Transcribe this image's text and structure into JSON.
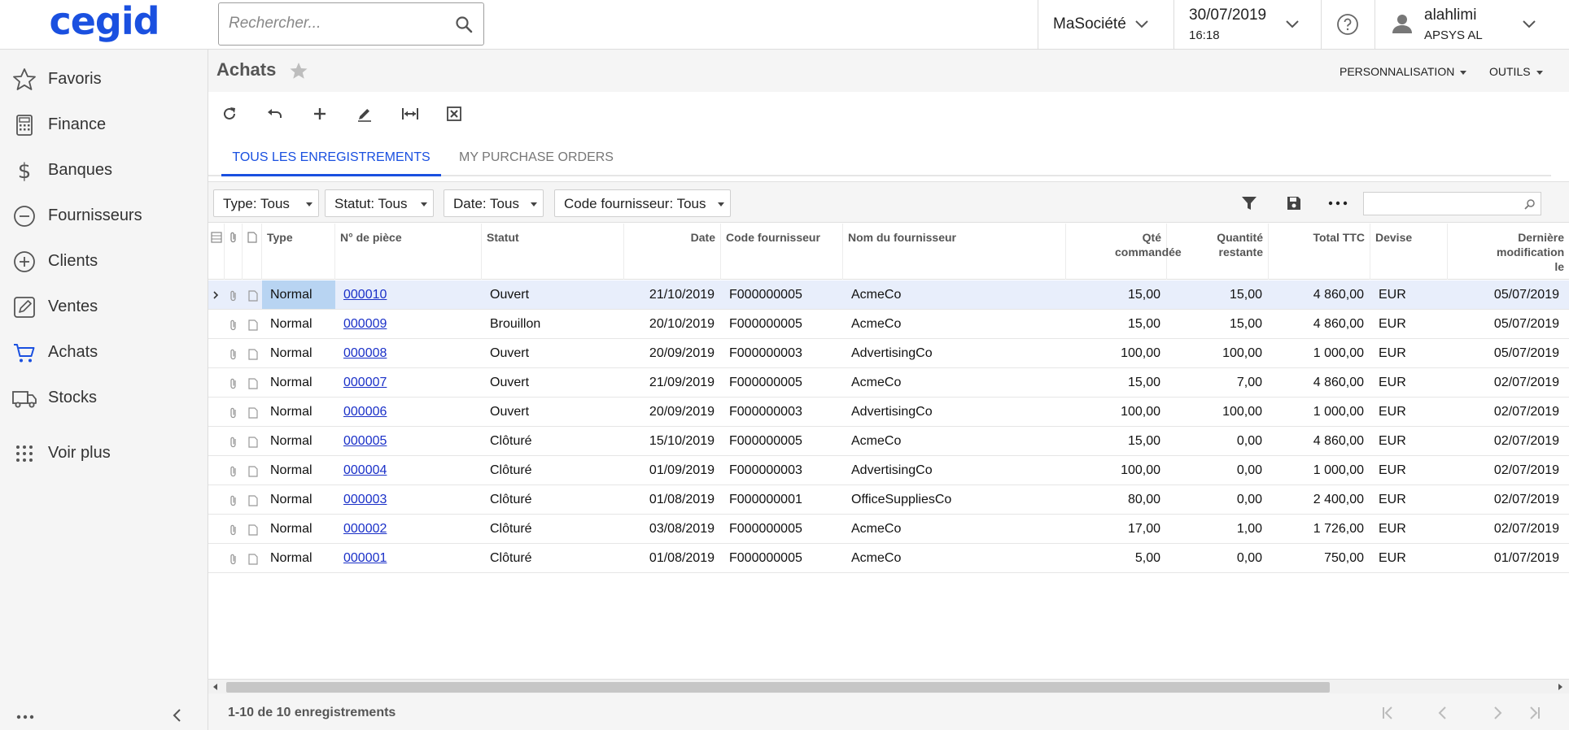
{
  "brand": {
    "logo_text": "cegid",
    "color": "#1a50e0"
  },
  "search": {
    "placeholder": "Rechercher..."
  },
  "company": {
    "label": "MaSociété"
  },
  "business_date": {
    "date": "30/07/2019",
    "time": "16:18"
  },
  "user": {
    "name": "alahlimi",
    "company": "APSYS AL"
  },
  "sidebar": {
    "items": [
      {
        "label": "Favoris",
        "icon": "star-icon"
      },
      {
        "label": "Finance",
        "icon": "calculator-icon"
      },
      {
        "label": "Banques",
        "icon": "dollar-icon"
      },
      {
        "label": "Fournisseurs",
        "icon": "minus-circle-icon"
      },
      {
        "label": "Clients",
        "icon": "plus-circle-icon"
      },
      {
        "label": "Ventes",
        "icon": "edit-icon"
      },
      {
        "label": "Achats",
        "icon": "cart-icon"
      },
      {
        "label": "Stocks",
        "icon": "truck-icon"
      },
      {
        "label": "Voir plus",
        "icon": "grid-dots-icon"
      }
    ]
  },
  "page": {
    "title": "Achats",
    "menus": {
      "customize": "PERSONNALISATION",
      "tools": "OUTILS"
    }
  },
  "toolbar": {
    "buttons": [
      "refresh-icon",
      "undo-icon",
      "add-icon",
      "edit-icon",
      "fit-columns-icon",
      "export-excel-icon"
    ]
  },
  "tabs": [
    {
      "label": "TOUS LES ENREGISTREMENTS",
      "active": true
    },
    {
      "label": "MY PURCHASE ORDERS",
      "active": false
    }
  ],
  "filters": [
    {
      "label": "Type: Tous"
    },
    {
      "label": "Statut: Tous"
    },
    {
      "label": "Date: Tous"
    },
    {
      "label": "Code fournisseur: Tous"
    }
  ],
  "grid": {
    "columns": {
      "type": "Type",
      "number": "N° de pièce",
      "status": "Statut",
      "date": "Date",
      "vendor_code": "Code fournisseur",
      "vendor_name": "Nom du fournisseur",
      "qty_ordered": "Qté commandée",
      "qty_remaining": "Quantité restante",
      "total": "Total TTC",
      "currency": "Devise",
      "last_modified": "Dernière modification le"
    },
    "rows": [
      {
        "type": "Normal",
        "number": "000010",
        "status": "Ouvert",
        "date": "21/10/2019",
        "vendor_code": "F000000005",
        "vendor_name": "AcmeCo",
        "qty_ordered": "15,00",
        "qty_remaining": "15,00",
        "total": "4 860,00",
        "currency": "EUR",
        "last_modified": "05/07/2019"
      },
      {
        "type": "Normal",
        "number": "000009",
        "status": "Brouillon",
        "date": "20/10/2019",
        "vendor_code": "F000000005",
        "vendor_name": "AcmeCo",
        "qty_ordered": "15,00",
        "qty_remaining": "15,00",
        "total": "4 860,00",
        "currency": "EUR",
        "last_modified": "05/07/2019"
      },
      {
        "type": "Normal",
        "number": "000008",
        "status": "Ouvert",
        "date": "20/09/2019",
        "vendor_code": "F000000003",
        "vendor_name": "AdvertisingCo",
        "qty_ordered": "100,00",
        "qty_remaining": "100,00",
        "total": "1 000,00",
        "currency": "EUR",
        "last_modified": "05/07/2019"
      },
      {
        "type": "Normal",
        "number": "000007",
        "status": "Ouvert",
        "date": "21/09/2019",
        "vendor_code": "F000000005",
        "vendor_name": "AcmeCo",
        "qty_ordered": "15,00",
        "qty_remaining": "7,00",
        "total": "4 860,00",
        "currency": "EUR",
        "last_modified": "02/07/2019"
      },
      {
        "type": "Normal",
        "number": "000006",
        "status": "Ouvert",
        "date": "20/09/2019",
        "vendor_code": "F000000003",
        "vendor_name": "AdvertisingCo",
        "qty_ordered": "100,00",
        "qty_remaining": "100,00",
        "total": "1 000,00",
        "currency": "EUR",
        "last_modified": "02/07/2019"
      },
      {
        "type": "Normal",
        "number": "000005",
        "status": "Clôturé",
        "date": "15/10/2019",
        "vendor_code": "F000000005",
        "vendor_name": "AcmeCo",
        "qty_ordered": "15,00",
        "qty_remaining": "0,00",
        "total": "4 860,00",
        "currency": "EUR",
        "last_modified": "02/07/2019"
      },
      {
        "type": "Normal",
        "number": "000004",
        "status": "Clôturé",
        "date": "01/09/2019",
        "vendor_code": "F000000003",
        "vendor_name": "AdvertisingCo",
        "qty_ordered": "100,00",
        "qty_remaining": "0,00",
        "total": "1 000,00",
        "currency": "EUR",
        "last_modified": "02/07/2019"
      },
      {
        "type": "Normal",
        "number": "000003",
        "status": "Clôturé",
        "date": "01/08/2019",
        "vendor_code": "F000000001",
        "vendor_name": "OfficeSuppliesCo",
        "qty_ordered": "80,00",
        "qty_remaining": "0,00",
        "total": "2 400,00",
        "currency": "EUR",
        "last_modified": "02/07/2019"
      },
      {
        "type": "Normal",
        "number": "000002",
        "status": "Clôturé",
        "date": "03/08/2019",
        "vendor_code": "F000000005",
        "vendor_name": "AcmeCo",
        "qty_ordered": "17,00",
        "qty_remaining": "1,00",
        "total": "1 726,00",
        "currency": "EUR",
        "last_modified": "02/07/2019"
      },
      {
        "type": "Normal",
        "number": "000001",
        "status": "Clôturé",
        "date": "01/08/2019",
        "vendor_code": "F000000005",
        "vendor_name": "AcmeCo",
        "qty_ordered": "5,00",
        "qty_remaining": "0,00",
        "total": "750,00",
        "currency": "EUR",
        "last_modified": "01/07/2019"
      }
    ]
  },
  "footer": {
    "record_count": "1-10 de 10 enregistrements"
  }
}
